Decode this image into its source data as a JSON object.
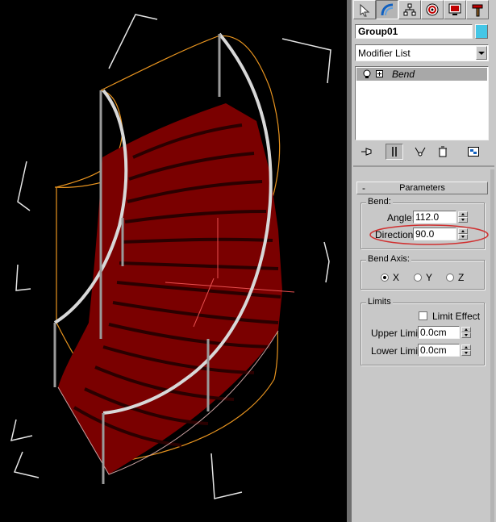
{
  "object": {
    "name": "Group01",
    "color": "#44c6e6"
  },
  "modifier_list": {
    "label": "Modifier List"
  },
  "stack": {
    "items": [
      {
        "label": "Bend"
      }
    ]
  },
  "parameters": {
    "rollout_toggle": "-",
    "title": "Parameters",
    "bend": {
      "group_label": "Bend:",
      "angle_label": "Angle:",
      "angle_value": "112.0",
      "direction_label": "Direction:",
      "direction_value": "90.0"
    },
    "bend_axis": {
      "group_label": "Bend Axis:",
      "options": [
        "X",
        "Y",
        "Z"
      ],
      "selected": "X"
    },
    "limits": {
      "group_label": "Limits",
      "limit_effect_label": "Limit Effect",
      "upper_label": "Upper Limit:",
      "upper_value": "0.0cm",
      "lower_label": "Lower Limit:",
      "lower_value": "0.0cm"
    }
  },
  "colors": {
    "stairs": "#7a0000",
    "gizmo": "#e8941f",
    "highlight_ellipse": "#d03030"
  }
}
